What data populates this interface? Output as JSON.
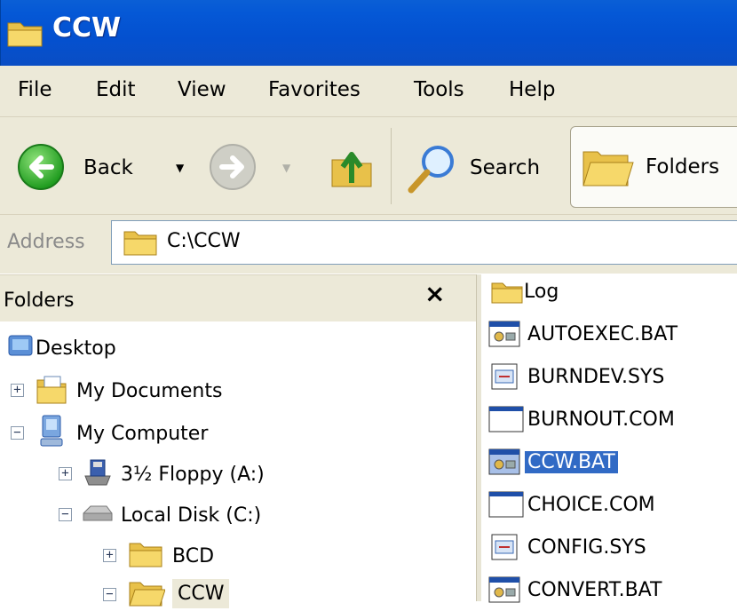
{
  "window": {
    "title": "CCW"
  },
  "menu": {
    "items": [
      "File",
      "Edit",
      "View",
      "Favorites",
      "Tools",
      "Help"
    ]
  },
  "toolbar": {
    "back_label": "Back",
    "search_label": "Search",
    "folders_label": "Folders"
  },
  "address": {
    "label": "Address",
    "value": "C:\\CCW"
  },
  "folders_pane": {
    "title": "Folders",
    "close_glyph": "×",
    "tree": [
      {
        "label": "Desktop",
        "icon": "desktop-icon",
        "expander": ""
      },
      {
        "label": "My Documents",
        "icon": "folder-icon",
        "expander": "+"
      },
      {
        "label": "My Computer",
        "icon": "computer-icon",
        "expander": "−"
      },
      {
        "label": "3½ Floppy (A:)",
        "icon": "floppy-icon",
        "expander": "+"
      },
      {
        "label": "Local Disk (C:)",
        "icon": "drive-icon",
        "expander": "−"
      },
      {
        "label": "BCD",
        "icon": "folder-icon",
        "expander": "+"
      },
      {
        "label": "CCW",
        "icon": "folder-open-icon",
        "expander": "−"
      }
    ]
  },
  "files": [
    {
      "name": "Log",
      "icon": "folder-icon",
      "selected": false
    },
    {
      "name": "AUTOEXEC.BAT",
      "icon": "batch-icon",
      "selected": false
    },
    {
      "name": "BURNDEV.SYS",
      "icon": "system-file-icon",
      "selected": false
    },
    {
      "name": "BURNOUT.COM",
      "icon": "program-icon",
      "selected": false
    },
    {
      "name": "CCW.BAT",
      "icon": "batch-icon",
      "selected": true
    },
    {
      "name": "CHOICE.COM",
      "icon": "program-icon",
      "selected": false
    },
    {
      "name": "CONFIG.SYS",
      "icon": "system-file-icon",
      "selected": false
    },
    {
      "name": "CONVERT.BAT",
      "icon": "batch-icon",
      "selected": false
    }
  ]
}
